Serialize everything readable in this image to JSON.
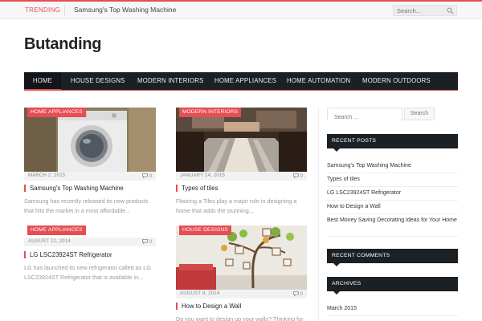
{
  "topbar": {
    "trending_label": "TRENDING",
    "trending_text": "Samsung's Top Washing Machine",
    "search_placeholder": "Search..."
  },
  "site": {
    "logo": "Butanding"
  },
  "nav": {
    "items": [
      {
        "label": "HOME",
        "active": true
      },
      {
        "label": "HOUSE DESIGNS"
      },
      {
        "label": "MODERN INTERIORS"
      },
      {
        "label": "HOME APPLIANCES"
      },
      {
        "label": "HOME AUTOMATION"
      },
      {
        "label": "MODERN OUTDOORS"
      }
    ]
  },
  "posts": [
    {
      "category": "HOME APPLIANCES",
      "date": "MARCH 2, 2015",
      "comments": "0",
      "title": "Samsung's Top Washing Machine",
      "excerpt": [
        "Samsung has recently released its new products",
        "that hits the market in a most affordable..."
      ]
    },
    {
      "category": "MODERN INTERIORS",
      "date": "JANUARY 14, 2015",
      "comments": "0",
      "title": "Types of tiles",
      "excerpt": [
        "Flooring a Tiles play a major role in designing a",
        "home that adds the stunning..."
      ]
    },
    {
      "category": "HOME APPLIANCES",
      "date": "AUGUST 12, 2014",
      "comments": "0",
      "title": "LG LSC23924ST Refrigerator",
      "excerpt": [
        "LG has launched its new refrigerator called as LG",
        "LSC23924ST Refrigerator that is available in..."
      ]
    },
    {
      "category": "HOUSE DESIGNS",
      "date": "AUGUST 8, 2014",
      "comments": "0",
      "title": "How to Design a Wall",
      "excerpt": [
        "Do you want to design up your walls? Thinking for"
      ]
    }
  ],
  "sidebar": {
    "search_placeholder": "Search ...",
    "search_button": "Search",
    "recent_posts_title": "RECENT POSTS",
    "recent_posts": [
      "Samsung's Top Washing Machine",
      "Types of tiles",
      "LG LSC23924ST Refrigerator",
      "How to Design a Wall",
      "Best Money Saving Decorating Ideas for Your Home"
    ],
    "recent_comments_title": "RECENT COMMENTS",
    "archives_title": "ARCHIVES",
    "archives": [
      "March 2015"
    ]
  },
  "colors": {
    "accent": "#e54e53",
    "nav_bg": "#1b2025"
  }
}
